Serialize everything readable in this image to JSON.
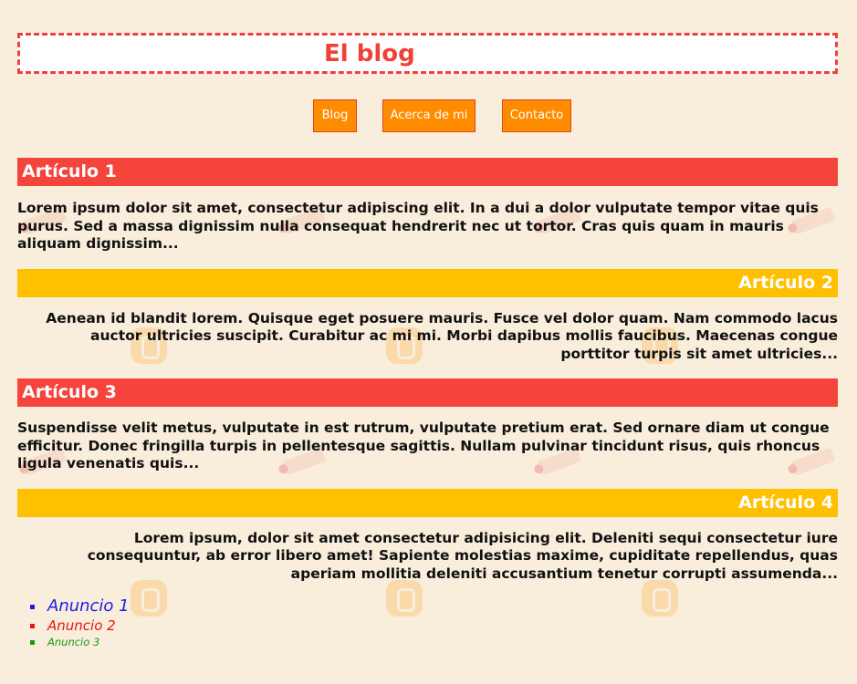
{
  "header": {
    "title": "El blog"
  },
  "nav": {
    "items": [
      "Blog",
      "Acerca de mi",
      "Contacto"
    ]
  },
  "articles": [
    {
      "title": "Artículo 1",
      "text": "Lorem ipsum dolor sit amet, consectetur adipiscing elit. In a dui a dolor vulputate tempor vitae quis purus. Sed a massa dignissim nulla consequat hendrerit nec ut tortor. Cras quis quam in mauris aliquam dignissim...",
      "color": "#f4443b"
    },
    {
      "title": "Artículo 2",
      "text": "Aenean id blandit lorem. Quisque eget posuere mauris. Fusce vel dolor quam. Nam commodo lacus auctor ultricies suscipit. Curabitur ac mi mi. Morbi dapibus mollis faucibus. Maecenas congue porttitor turpis sit amet ultricies...",
      "color": "#ffc000"
    },
    {
      "title": "Artículo 3",
      "text": "Suspendisse velit metus, vulputate in est rutrum, vulputate pretium erat. Sed ornare diam ut congue efficitur. Donec fringilla turpis in pellentesque sagittis. Nullam pulvinar tincidunt risus, quis rhoncus ligula venenatis quis...",
      "color": "#f4443b"
    },
    {
      "title": "Artículo 4",
      "text": "Lorem ipsum, dolor sit amet consectetur adipisicing elit. Deleniti sequi consectetur iure consequuntur, ab error libero amet! Sapiente molestias maxime, cupiditate repellendus, quas aperiam mollitia deleniti accusantium tenetur corrupti assumenda...",
      "color": "#ffc000"
    }
  ],
  "ads": [
    "Anuncio 1",
    "Anuncio 2",
    "Anuncio 3"
  ],
  "colors": {
    "background": "#f9eddc",
    "title": "#ef4136",
    "nav_button": "#ff8c00",
    "ad_1": "#1e1ee6",
    "ad_2": "#e81515",
    "ad_3": "#159a15"
  },
  "background_icons": [
    "pencil-icon",
    "blogger-icon"
  ]
}
